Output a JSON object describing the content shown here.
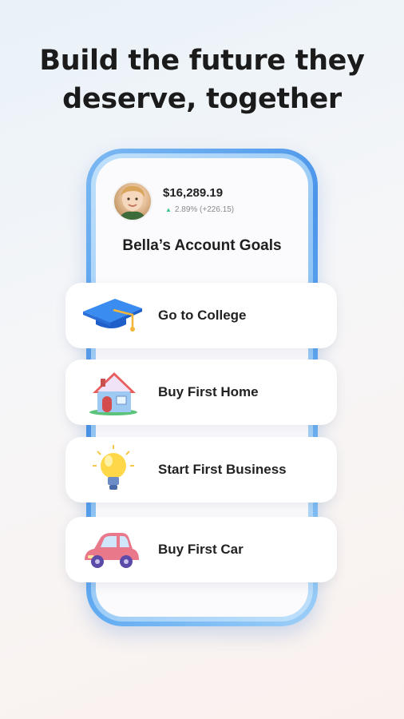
{
  "headline": {
    "line1": "Build the future they",
    "line2": "deserve, together"
  },
  "account": {
    "balance": "$16,289.19",
    "change": "2.89% (+226.15)",
    "change_icon": "up-arrow-icon",
    "goals_title": "Bella’s Account Goals"
  },
  "goals": [
    {
      "label": "Go to College",
      "icon": "graduation-cap-icon"
    },
    {
      "label": "Buy First Home",
      "icon": "house-icon"
    },
    {
      "label": "Start First Business",
      "icon": "lightbulb-icon"
    },
    {
      "label": "Buy First Car",
      "icon": "car-icon"
    }
  ],
  "colors": {
    "accent": "#4a94ea",
    "positive": "#38c08a",
    "text": "#1b1b1b"
  }
}
